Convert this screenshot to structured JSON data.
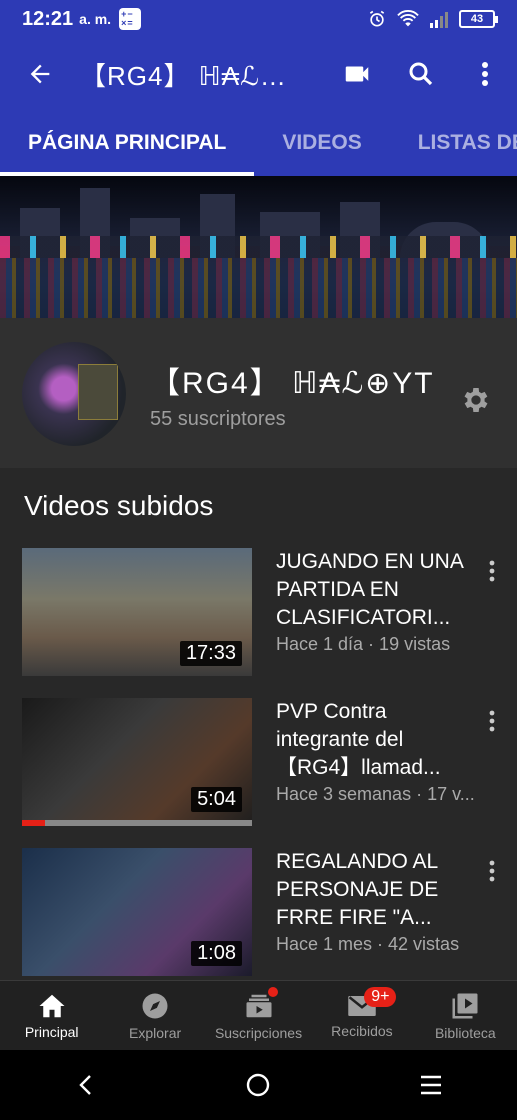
{
  "status": {
    "time": "12:21",
    "ampm": "a. m.",
    "battery": "43"
  },
  "appbar": {
    "title": "【RG4】 ℍ₳ℒ⊕..."
  },
  "tabs": [
    {
      "label": "PÁGINA PRINCIPAL"
    },
    {
      "label": "VIDEOS"
    },
    {
      "label": "LISTAS DE"
    }
  ],
  "channel": {
    "name": "【RG4】 ℍ₳ℒ⊕YT",
    "subscribers": "55 suscriptores"
  },
  "section_title": "Videos subidos",
  "videos": [
    {
      "title": "JUGANDO EN UNA PARTIDA EN CLASIFICATORI...",
      "meta": "Hace 1 día · 19 vistas",
      "duration": "17:33",
      "progress": 0
    },
    {
      "title": "PVP Contra integrante del 【RG4】llamad...",
      "meta": "Hace 3 semanas · 17 v...",
      "duration": "5:04",
      "progress": 0.1
    },
    {
      "title": "REGALANDO AL PERSONAJE DE FRRE FIRE \"A...",
      "meta": "Hace 1 mes · 42 vistas",
      "duration": "1:08",
      "progress": 0
    }
  ],
  "bottom_nav": [
    {
      "label": "Principal"
    },
    {
      "label": "Explorar"
    },
    {
      "label": "Suscripciones"
    },
    {
      "label": "Recibidos",
      "badge": "9+"
    },
    {
      "label": "Biblioteca"
    }
  ],
  "colors": {
    "app_bar": "#2d3ab5",
    "background": "#282828",
    "accent_red": "#e62117"
  }
}
